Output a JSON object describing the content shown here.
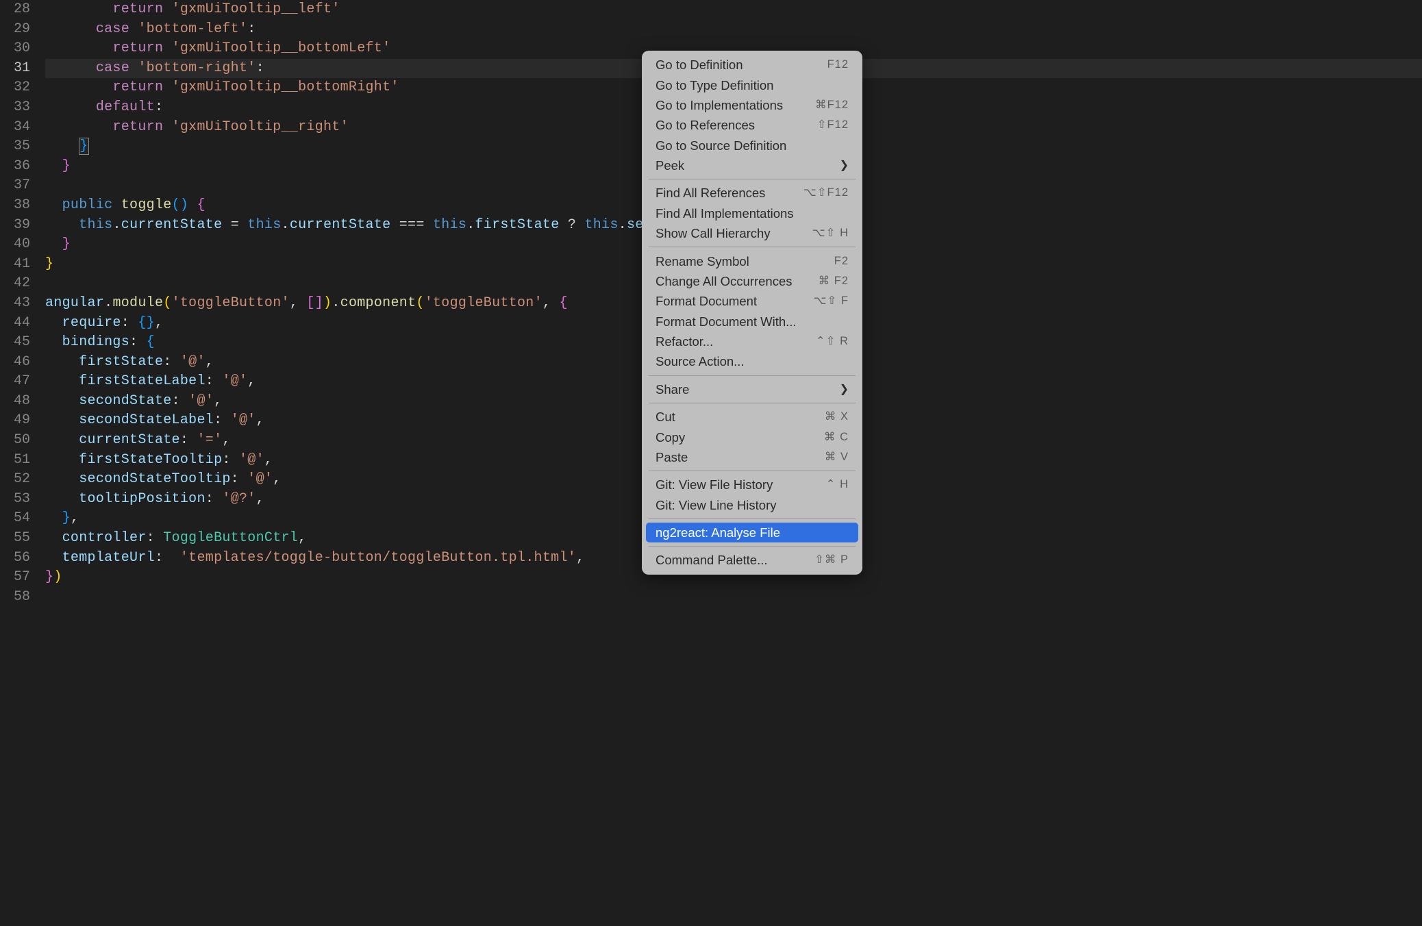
{
  "lineNumbers": [
    28,
    29,
    30,
    31,
    32,
    33,
    34,
    35,
    36,
    37,
    38,
    39,
    40,
    41,
    42,
    43,
    44,
    45,
    46,
    47,
    48,
    49,
    50,
    51,
    52,
    53,
    54,
    55,
    56,
    57,
    58
  ],
  "activeLineNumber": 31,
  "code": {
    "l28": {
      "kw": "return",
      "str": "'gxmUiTooltip__left'"
    },
    "l29": {
      "kw": "case",
      "str": "'bottom-left'",
      "colon": ":"
    },
    "l30": {
      "kw": "return",
      "str": "'gxmUiTooltip__bottomLeft'"
    },
    "l31": {
      "kw": "case",
      "str": "'bottom-right'",
      "colon": ":"
    },
    "l32": {
      "kw": "return",
      "str": "'gxmUiTooltip__bottomRight'"
    },
    "l33": {
      "kw": "default",
      "colon": ":"
    },
    "l34": {
      "kw": "return",
      "str": "'gxmUiTooltip__right'"
    },
    "l35": {
      "brace": "}"
    },
    "l36": {
      "brace": "}"
    },
    "l38": {
      "public": "public",
      "fn": "toggle",
      "parens": "()",
      "brace": "{"
    },
    "l39": {
      "this1": "this",
      "dot1": ".",
      "prop1": "currentState",
      "eq": " = ",
      "this2": "this",
      "dot2": ".",
      "prop2": "currentState",
      "triple": " === ",
      "this3": "this",
      "dot3": ".",
      "prop3": "firstState",
      "q": " ? ",
      "this4": "this",
      "dot4": ".",
      "prop4": "sec"
    },
    "l40": {
      "brace": "}"
    },
    "l41": {
      "brace": "}"
    },
    "l43": {
      "id": "angular",
      "dot1": ".",
      "fn1": "module",
      "op": "(",
      "str1": "'toggleButton'",
      "comma1": ", ",
      "arr": "[]",
      "cp": ")",
      "dot2": ".",
      "fn2": "component",
      "op2": "(",
      "str2": "'toggleButton'",
      "comma2": ", ",
      "brace": "{"
    },
    "l44": {
      "id": "require",
      "colon": ": ",
      "braces": "{}",
      "comma": ","
    },
    "l45": {
      "id": "bindings",
      "colon": ": ",
      "brace": "{"
    },
    "l46": {
      "id": "firstState",
      "colon": ": ",
      "str": "'@'",
      "comma": ","
    },
    "l47": {
      "id": "firstStateLabel",
      "colon": ": ",
      "str": "'@'",
      "comma": ","
    },
    "l48": {
      "id": "secondState",
      "colon": ": ",
      "str": "'@'",
      "comma": ","
    },
    "l49": {
      "id": "secondStateLabel",
      "colon": ": ",
      "str": "'@'",
      "comma": ","
    },
    "l50": {
      "id": "currentState",
      "colon": ": ",
      "str": "'='",
      "comma": ","
    },
    "l51": {
      "id": "firstStateTooltip",
      "colon": ": ",
      "str": "'@'",
      "comma": ","
    },
    "l52": {
      "id": "secondStateTooltip",
      "colon": ": ",
      "str": "'@'",
      "comma": ","
    },
    "l53": {
      "id": "tooltipPosition",
      "colon": ": ",
      "str": "'@?'",
      "comma": ","
    },
    "l54": {
      "brace": "}",
      "comma": ","
    },
    "l55": {
      "id": "controller",
      "colon": ": ",
      "type": "ToggleButtonCtrl",
      "comma": ","
    },
    "l56": {
      "id": "templateUrl",
      "colon": ":  ",
      "str": "'templates/toggle-button/toggleButton.tpl.html'",
      "comma": ","
    },
    "l57": {
      "brace": "}",
      "paren": ")"
    }
  },
  "contextMenu": {
    "groups": [
      [
        {
          "label": "Go to Definition",
          "shortcut": "F12",
          "chevron": false
        },
        {
          "label": "Go to Type Definition",
          "shortcut": "",
          "chevron": false
        },
        {
          "label": "Go to Implementations",
          "shortcut": "⌘F12",
          "chevron": false
        },
        {
          "label": "Go to References",
          "shortcut": "⇧F12",
          "chevron": false
        },
        {
          "label": "Go to Source Definition",
          "shortcut": "",
          "chevron": false
        },
        {
          "label": "Peek",
          "shortcut": "",
          "chevron": true
        }
      ],
      [
        {
          "label": "Find All References",
          "shortcut": "⌥⇧F12",
          "chevron": false
        },
        {
          "label": "Find All Implementations",
          "shortcut": "",
          "chevron": false
        },
        {
          "label": "Show Call Hierarchy",
          "shortcut": "⌥⇧ H",
          "chevron": false
        }
      ],
      [
        {
          "label": "Rename Symbol",
          "shortcut": "F2",
          "chevron": false
        },
        {
          "label": "Change All Occurrences",
          "shortcut": "⌘ F2",
          "chevron": false
        },
        {
          "label": "Format Document",
          "shortcut": "⌥⇧ F",
          "chevron": false
        },
        {
          "label": "Format Document With...",
          "shortcut": "",
          "chevron": false
        },
        {
          "label": "Refactor...",
          "shortcut": "⌃⇧ R",
          "chevron": false
        },
        {
          "label": "Source Action...",
          "shortcut": "",
          "chevron": false
        }
      ],
      [
        {
          "label": "Share",
          "shortcut": "",
          "chevron": true
        }
      ],
      [
        {
          "label": "Cut",
          "shortcut": "⌘ X",
          "chevron": false
        },
        {
          "label": "Copy",
          "shortcut": "⌘ C",
          "chevron": false
        },
        {
          "label": "Paste",
          "shortcut": "⌘ V",
          "chevron": false
        }
      ],
      [
        {
          "label": "Git: View File History",
          "shortcut": "⌃ H",
          "chevron": false
        },
        {
          "label": "Git: View Line History",
          "shortcut": "",
          "chevron": false
        }
      ],
      [
        {
          "label": "ng2react: Analyse File",
          "shortcut": "",
          "chevron": false,
          "highlight": true
        }
      ],
      [
        {
          "label": "Command Palette...",
          "shortcut": "⇧⌘ P",
          "chevron": false
        }
      ]
    ]
  }
}
